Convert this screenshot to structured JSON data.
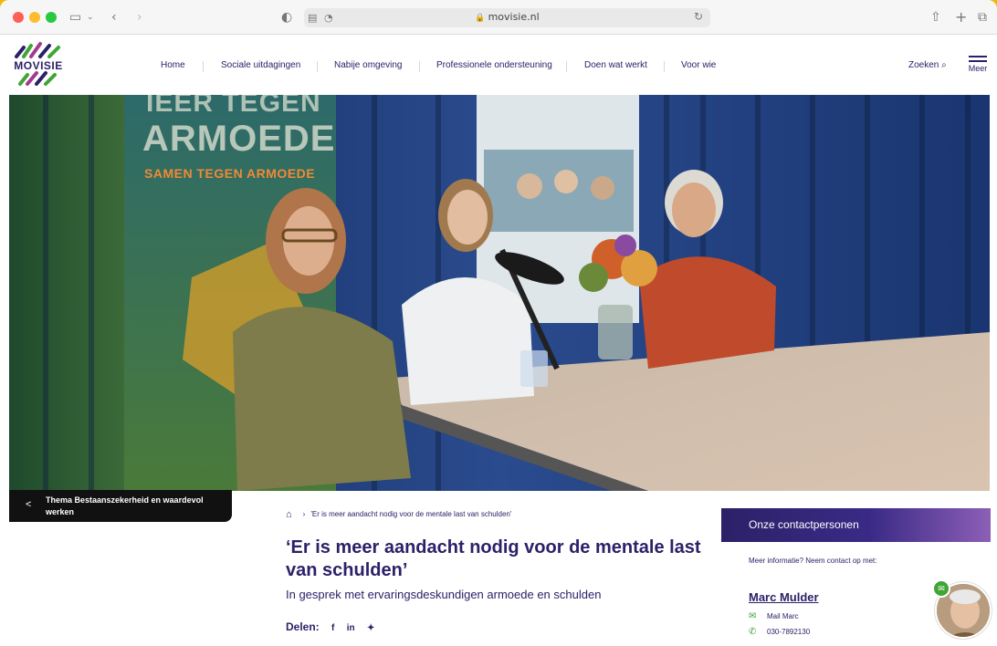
{
  "browser": {
    "url": "movisie.nl",
    "icons": [
      "sidebar-icon",
      "chevron-left-icon",
      "chevron-right-icon",
      "shield-icon",
      "reader-icon",
      "clock-icon",
      "lock-icon",
      "reload-icon",
      "share-icon",
      "new-tab-icon",
      "tabs-icon"
    ]
  },
  "site": {
    "logo": "MOVISIE",
    "nav": [
      "Home",
      "Sociale uitdagingen",
      "Nabije omgeving",
      "Professionele ondersteuning",
      "Doen wat werkt",
      "Voor wie"
    ],
    "search_label": "Zoeken",
    "menu_label": "Meer",
    "colors": {
      "brand": "#2c2168",
      "accent": "#3fa535",
      "highlight": "#f2b705"
    }
  },
  "hero": {
    "banner_line1": "IEER TEGEN",
    "banner_line2": "ARMOEDE",
    "banner_line3": "SAMEN TEGEN ARMOEDE"
  },
  "back_link": "Thema Bestaanszekerheid en waardevol werken",
  "article": {
    "breadcrumb": "'Er is meer aandacht nodig voor de mentale last van schulden'",
    "title": "‘Er is meer aandacht nodig voor de mentale last van schulden’",
    "subtitle": "In gesprek met ervaringsdeskundigen armoede en schulden",
    "share_label": "Delen:",
    "share_icons": [
      "f",
      "in",
      "✦"
    ]
  },
  "contact": {
    "heading": "Onze contactpersonen",
    "intro": "Meer informatie? Neem contact op met:",
    "name": "Marc Mulder",
    "mail": "Mail Marc",
    "phone": "030-7892130"
  }
}
